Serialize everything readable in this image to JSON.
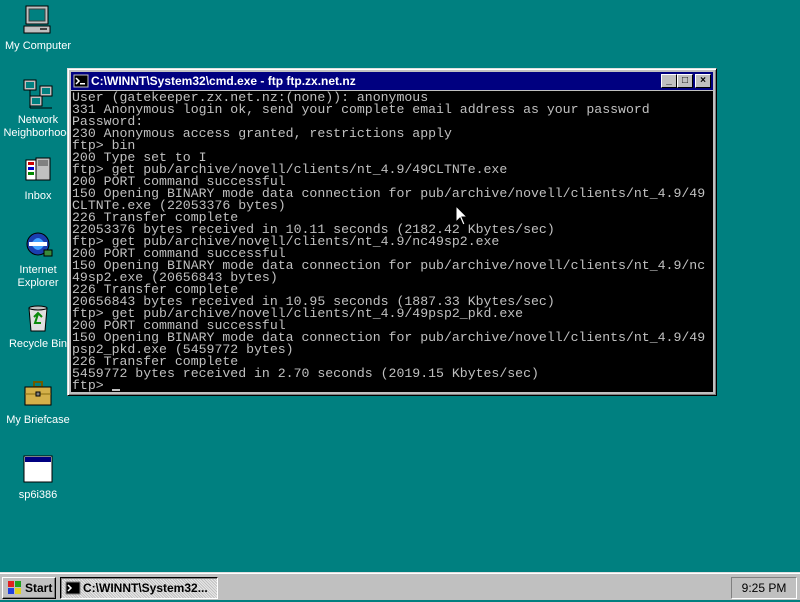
{
  "desktop": {
    "icons": [
      {
        "label": "My Computer",
        "icon": "my-computer-icon"
      },
      {
        "label": "Network Neighborhood",
        "icon": "network-neighborhood-icon"
      },
      {
        "label": "Inbox",
        "icon": "inbox-icon"
      },
      {
        "label": "Internet Explorer",
        "icon": "internet-explorer-icon"
      },
      {
        "label": "Recycle Bin",
        "icon": "recycle-bin-icon"
      },
      {
        "label": "My Briefcase",
        "icon": "briefcase-icon"
      },
      {
        "label": "sp6i386",
        "icon": "application-window-icon"
      }
    ]
  },
  "window": {
    "title": "C:\\WINNT\\System32\\cmd.exe - ftp ftp.zx.net.nz",
    "buttons": {
      "minimize": "_",
      "maximize": "□",
      "close": "×"
    },
    "lines": [
      "User (gatekeeper.zx.net.nz:(none)): anonymous",
      "331 Anonymous login ok, send your complete email address as your password",
      "Password:",
      "230 Anonymous access granted, restrictions apply",
      "ftp> bin",
      "200 Type set to I",
      "ftp> get pub/archive/novell/clients/nt_4.9/49CLTNTe.exe",
      "200 PORT command successful",
      "150 Opening BINARY mode data connection for pub/archive/novell/clients/nt_4.9/49",
      "CLTNTe.exe (22053376 bytes)",
      "226 Transfer complete",
      "22053376 bytes received in 10.11 seconds (2182.42 Kbytes/sec)",
      "ftp> get pub/archive/novell/clients/nt_4.9/nc49sp2.exe",
      "200 PORT command successful",
      "150 Opening BINARY mode data connection for pub/archive/novell/clients/nt_4.9/nc",
      "49sp2.exe (20656843 bytes)",
      "226 Transfer complete",
      "20656843 bytes received in 10.95 seconds (1887.33 Kbytes/sec)",
      "ftp> get pub/archive/novell/clients/nt_4.9/49psp2_pkd.exe",
      "200 PORT command successful",
      "150 Opening BINARY mode data connection for pub/archive/novell/clients/nt_4.9/49",
      "psp2_pkd.exe (5459772 bytes)",
      "226 Transfer complete",
      "5459772 bytes received in 2.70 seconds (2019.15 Kbytes/sec)"
    ],
    "prompt": "ftp> "
  },
  "taskbar": {
    "start_label": "Start",
    "task_label": "C:\\WINNT\\System32...",
    "clock": "9:25 PM"
  }
}
